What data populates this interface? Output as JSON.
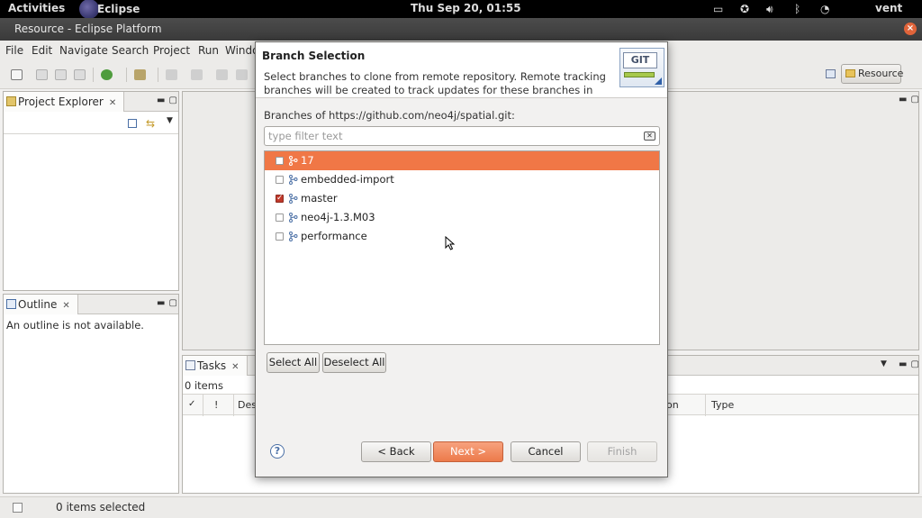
{
  "topbar": {
    "activities": "Activities",
    "app": "Eclipse",
    "clock": "Thu Sep 20, 01:55",
    "user": "vent"
  },
  "window": {
    "title": "Resource - Eclipse Platform"
  },
  "menu": [
    "File",
    "Edit",
    "Navigate",
    "Search",
    "Project",
    "Run",
    "Windo"
  ],
  "perspective": {
    "label": "Resource"
  },
  "project_explorer": {
    "title": "Project Explorer"
  },
  "outline": {
    "title": "Outline",
    "message": "An outline is not available."
  },
  "tasks": {
    "title": "Tasks",
    "count": "0 items",
    "columns": [
      "✓",
      "!",
      "Des",
      "on",
      "Type"
    ]
  },
  "statusbar": {
    "text": "0 items selected"
  },
  "dialog": {
    "title": "Branch Selection",
    "description": "Select branches to clone from remote repository. Remote tracking branches will be created to track updates for these branches in the",
    "logo_text": "GIT",
    "branches_label": "Branches of https://github.com/neo4j/spatial.git:",
    "filter_placeholder": "type filter text",
    "branches": [
      {
        "name": "17",
        "checked": false,
        "selected": true
      },
      {
        "name": "embedded-import",
        "checked": false,
        "selected": false
      },
      {
        "name": "master",
        "checked": true,
        "selected": false
      },
      {
        "name": "neo4j-1.3.M03",
        "checked": false,
        "selected": false
      },
      {
        "name": "performance",
        "checked": false,
        "selected": false
      }
    ],
    "buttons": {
      "select_all": "Select All",
      "deselect_all": "Deselect All",
      "help": "?",
      "back": "< Back",
      "next": "Next >",
      "cancel": "Cancel",
      "finish": "Finish"
    }
  },
  "colors": {
    "selection": "#f07746",
    "primary_button": "#ec7a4a"
  }
}
